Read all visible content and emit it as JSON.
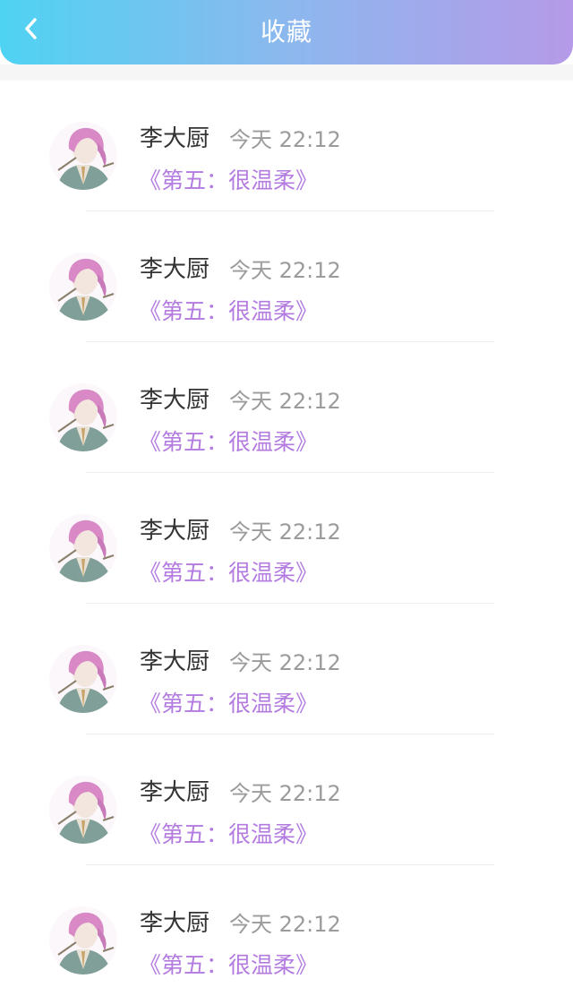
{
  "header": {
    "title": "收藏",
    "back_icon": "chevron-left-icon",
    "gradient": [
      "#4fd3f2",
      "#b59ae8"
    ]
  },
  "favorites": [
    {
      "name": "李大厨",
      "time": "今天 22:12",
      "book": "《第五：很温柔》"
    },
    {
      "name": "李大厨",
      "time": "今天 22:12",
      "book": "《第五：很温柔》"
    },
    {
      "name": "李大厨",
      "time": "今天 22:12",
      "book": "《第五：很温柔》"
    },
    {
      "name": "李大厨",
      "time": "今天 22:12",
      "book": "《第五：很温柔》"
    },
    {
      "name": "李大厨",
      "time": "今天 22:12",
      "book": "《第五：很温柔》"
    },
    {
      "name": "李大厨",
      "time": "今天 22:12",
      "book": "《第五：很温柔》"
    },
    {
      "name": "李大厨",
      "time": "今天 22:12",
      "book": "《第五：很温柔》"
    }
  ],
  "colors": {
    "name": "#333333",
    "time": "#9b9b9b",
    "book": "#b37be0"
  }
}
